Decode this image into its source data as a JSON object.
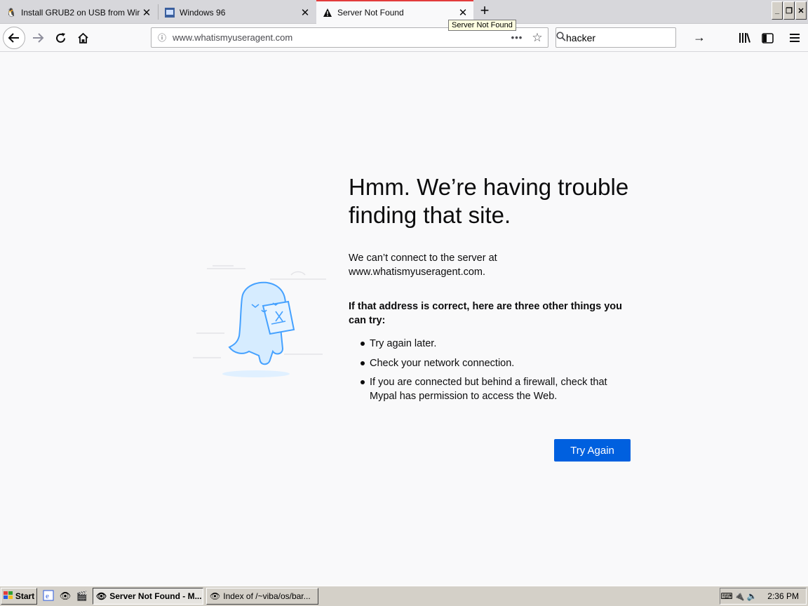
{
  "tabs": [
    {
      "title": "Install GRUB2 on USB from Wir",
      "favicon": "penguin-icon"
    },
    {
      "title": "Windows 96",
      "favicon": "windows96-icon"
    },
    {
      "title": "Server Not Found",
      "favicon": "warning-icon"
    }
  ],
  "tooltip": "Server Not Found",
  "navbar": {
    "url": "www.whatismyuseragent.com",
    "search_value": "hacker"
  },
  "error": {
    "title": "Hmm. We’re having trouble finding that site.",
    "description": "We can’t connect to the server at www.whatismyuseragent.com.",
    "hint": "If that address is correct, here are three other things you can try:",
    "items": [
      "Try again later.",
      "Check your network connection.",
      "If you are connected but behind a firewall, check that Mypal has permission to access the Web."
    ],
    "button": "Try Again"
  },
  "taskbar": {
    "start_label": "Start",
    "buttons": [
      {
        "label": "Server Not Found - M..."
      },
      {
        "label": "Index of /~viba/os/bar..."
      }
    ],
    "clock": "2:36 PM"
  },
  "colors": {
    "accent": "#0060df",
    "active_tab_line": "#e23c3c",
    "illustration": "#45a1ff"
  }
}
